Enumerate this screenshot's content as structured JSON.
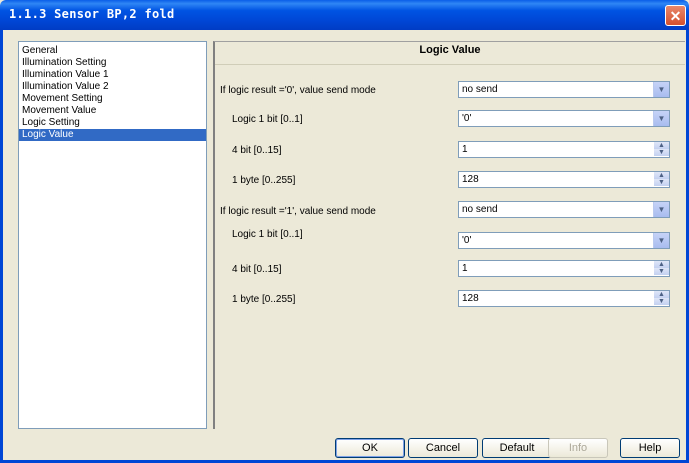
{
  "window": {
    "title": "1.1.3 Sensor BP,2 fold",
    "close_glyph": "✕"
  },
  "tree": {
    "items": [
      {
        "label": "General"
      },
      {
        "label": "Illumination Setting"
      },
      {
        "label": "Illumination Value 1"
      },
      {
        "label": "Illumination Value 2"
      },
      {
        "label": "Movement Setting"
      },
      {
        "label": "Movement Value"
      },
      {
        "label": "Logic Setting"
      },
      {
        "label": "Logic Value",
        "selected": true
      }
    ]
  },
  "panel": {
    "title": "Logic Value",
    "rows": [
      {
        "label": "If logic result ='0', value send mode",
        "value": "no send",
        "control": "dropdown"
      },
      {
        "label": "Logic 1 bit [0..1]",
        "value": "'0'",
        "control": "dropdown"
      },
      {
        "label": "4 bit [0..15]",
        "value": "1",
        "control": "spinner"
      },
      {
        "label": "1 byte [0..255]",
        "value": "128",
        "control": "spinner"
      },
      {
        "label": "If logic result ='1', value send mode",
        "value": "no send",
        "control": "dropdown"
      },
      {
        "label": "Logic 1 bit [0..1]",
        "value": "'0'",
        "control": "dropdown"
      },
      {
        "label": "4 bit [0..15]",
        "value": "1",
        "control": "spinner"
      },
      {
        "label": "1 byte [0..255]",
        "value": "128",
        "control": "spinner"
      }
    ]
  },
  "buttons": {
    "ok": "OK",
    "cancel": "Cancel",
    "default": "Default",
    "info": "Info",
    "help": "Help"
  },
  "icons": {
    "dropdown": "chevron-down-icon",
    "spinner": "spin-up-down-icon"
  },
  "colors": {
    "titlebar": "#0054e3",
    "selection": "#316ac5",
    "background": "#ece9d8"
  }
}
